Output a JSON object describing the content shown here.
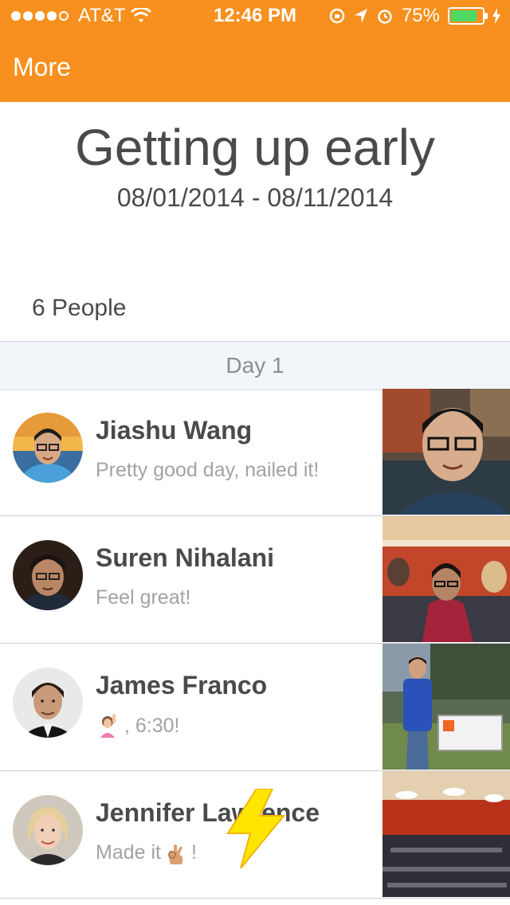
{
  "status_bar": {
    "carrier": "AT&T",
    "time": "12:46 PM",
    "battery": "75%"
  },
  "nav": {
    "back_label": "More"
  },
  "challenge": {
    "title": "Getting up early",
    "dates": "08/01/2014 - 08/11/2014",
    "people_count": "6 People"
  },
  "section": {
    "day_label": "Day 1"
  },
  "entries": [
    {
      "name": "Jiashu Wang",
      "message": "Pretty good day, nailed it!"
    },
    {
      "name": "Suren Nihalani",
      "message": "Feel great!"
    },
    {
      "name": "James Franco",
      "message": ", 6:30!"
    },
    {
      "name": "Jennifer Lawrence",
      "message": "Made it",
      "message_suffix": "!"
    }
  ],
  "colors": {
    "brand": "#f7901e",
    "section_bg": "#f2f5fa",
    "message": "#a3a3a3"
  }
}
